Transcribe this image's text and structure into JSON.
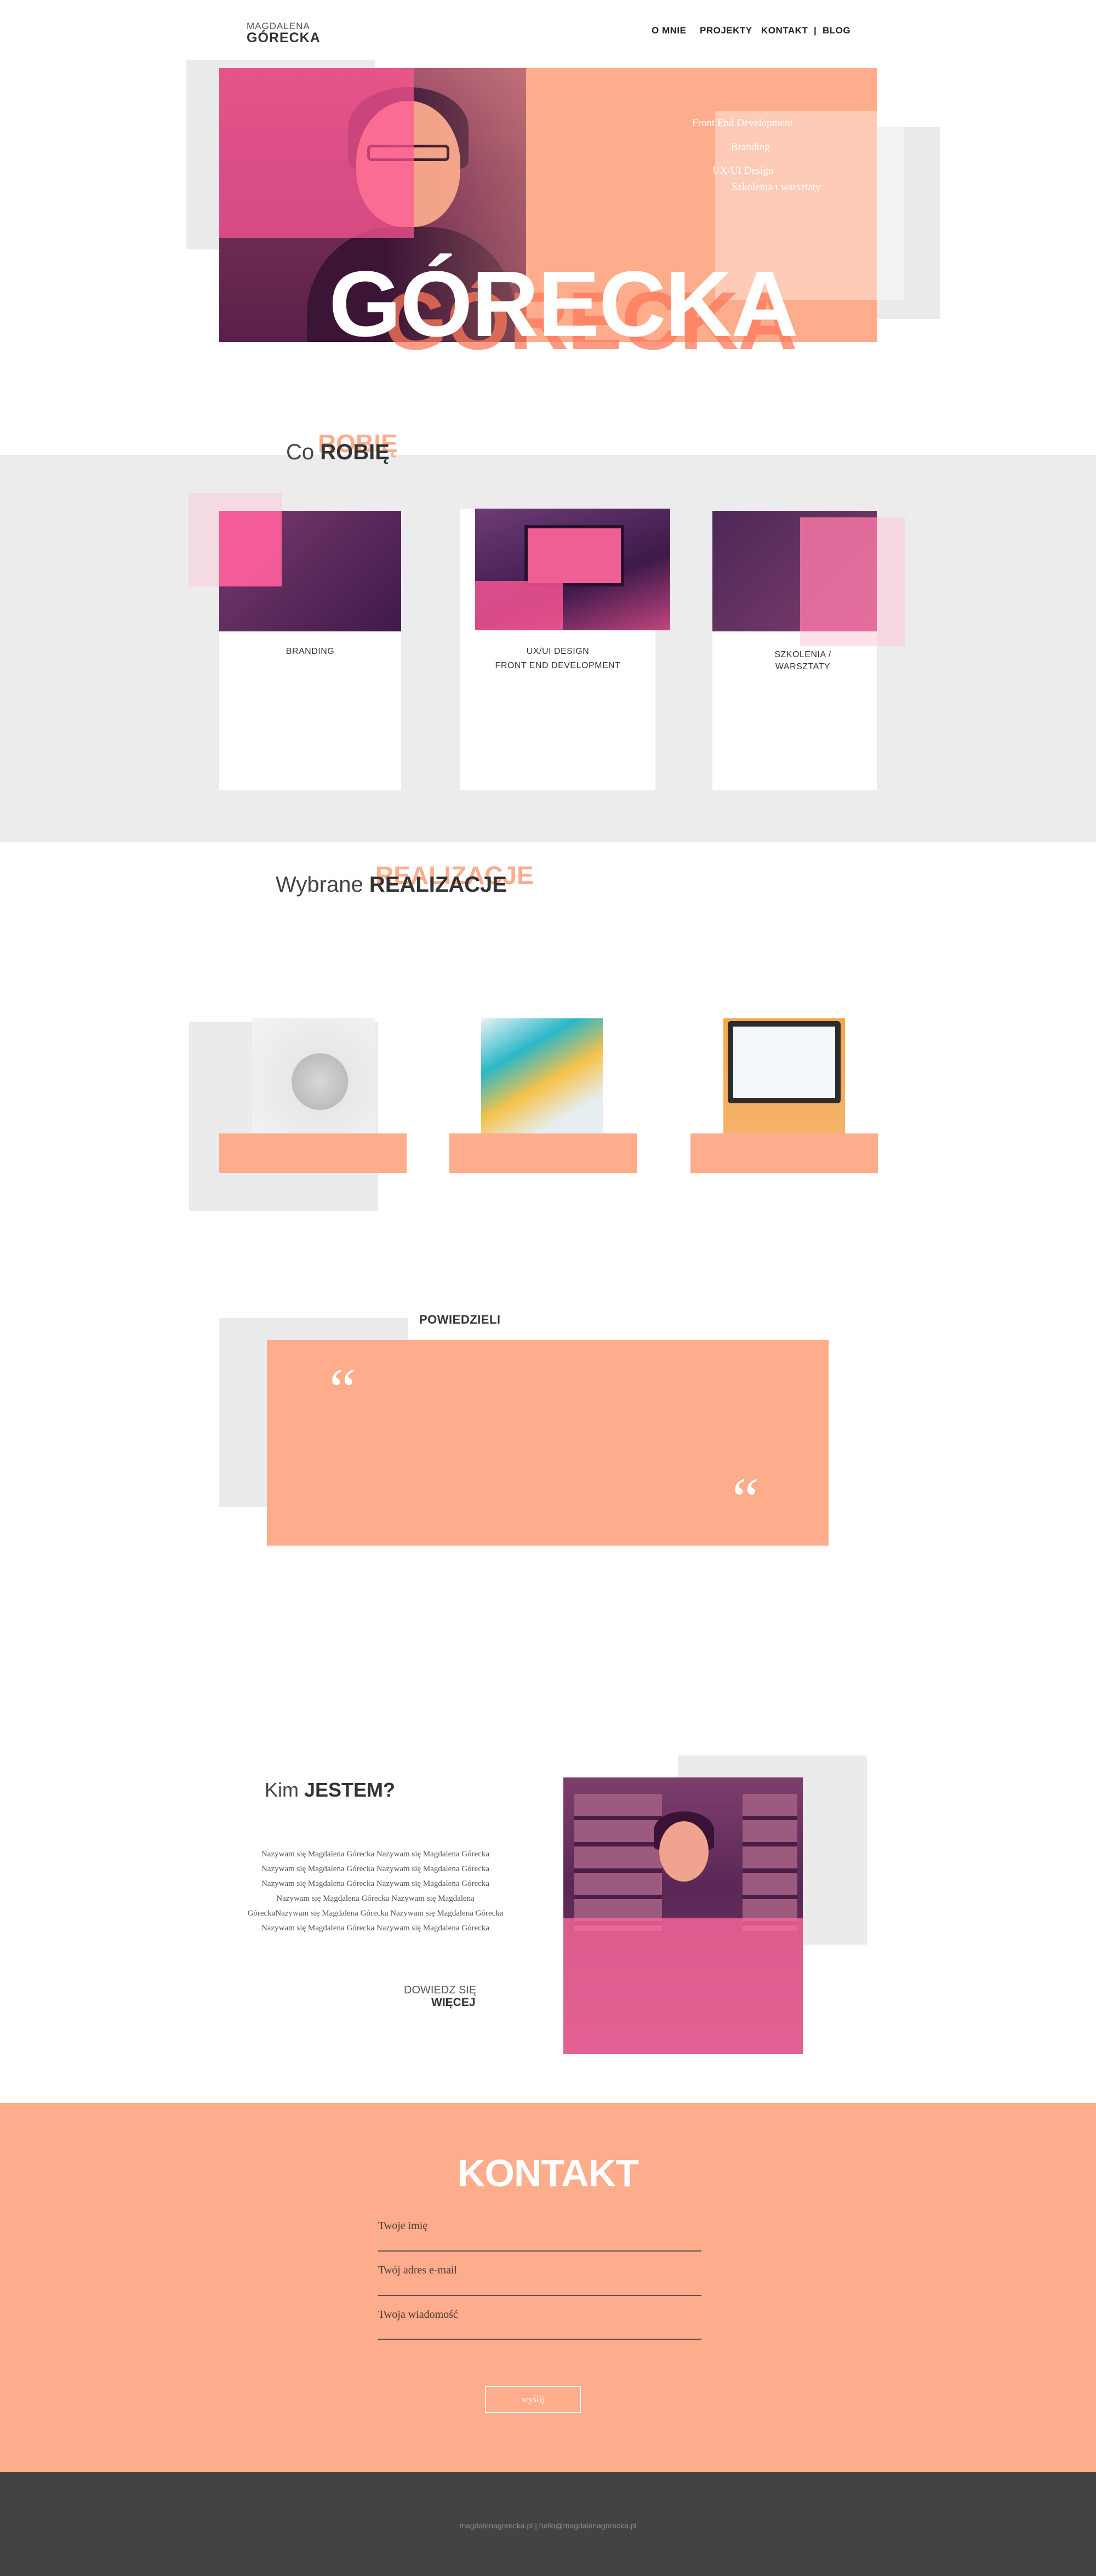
{
  "header": {
    "logo_top": "MAGDALENA",
    "logo_bottom": "GÓRECKA",
    "nav": [
      "O MNIE",
      "PROJEKTY",
      "KONTAKT",
      "|",
      "BLOG"
    ]
  },
  "hero": {
    "services": [
      "Front End Development",
      "Branding",
      "UX/UI Design",
      "Szkolenia i warsztaty"
    ],
    "title": "GÓRECKA"
  },
  "what_i_do": {
    "heading_light": "Co ",
    "heading_bold": "ROBIĘ",
    "heading_shadow": "ROBIĘ",
    "cards": [
      {
        "label": "BRANDING"
      },
      {
        "label": "UX/UI DESIGN",
        "label2": "FRONT END DEVELOPMENT"
      },
      {
        "label": "SZKOLENIA / WARSZTATY"
      }
    ]
  },
  "projects": {
    "heading_light": "Wybrane ",
    "heading_bold": "REALIZACJE",
    "heading_shadow": "REALIZACJE"
  },
  "testimonials": {
    "heading": "POWIEDZIELI",
    "quote_open": "“",
    "quote_close": "“"
  },
  "about": {
    "heading_light": "Kim ",
    "heading_bold": "JESTEM?",
    "text": "Nazywam się Magdalena Górecka Nazywam się Magdalena Górecka Nazywam się Magdalena Górecka Nazywam się Magdalena Górecka Nazywam się Magdalena Górecka Nazywam się Magdalena Górecka Nazywam się Magdalena Górecka Nazywam się Magdalena GóreckaNazywam się Magdalena Górecka Nazywam się Magdalena Górecka Nazywam się Magdalena Górecka Nazywam się Magdalena Górecka",
    "link_light": "DOWIEDZ SIĘ",
    "link_bold": "WIĘCEJ"
  },
  "contact": {
    "title": "KONTAKT",
    "fields": [
      "Twoje imię",
      "Twój adres e-mail",
      "Twoja wiadomość"
    ],
    "send": "wyślij"
  },
  "footer": {
    "text": "magdalenagorecka.pl  |  hello@magdalenagorecka.pl"
  },
  "colors": {
    "accent": "#fdac8c",
    "pink": "#ff5896",
    "grey": "#ebebeb",
    "footer": "#434343"
  }
}
